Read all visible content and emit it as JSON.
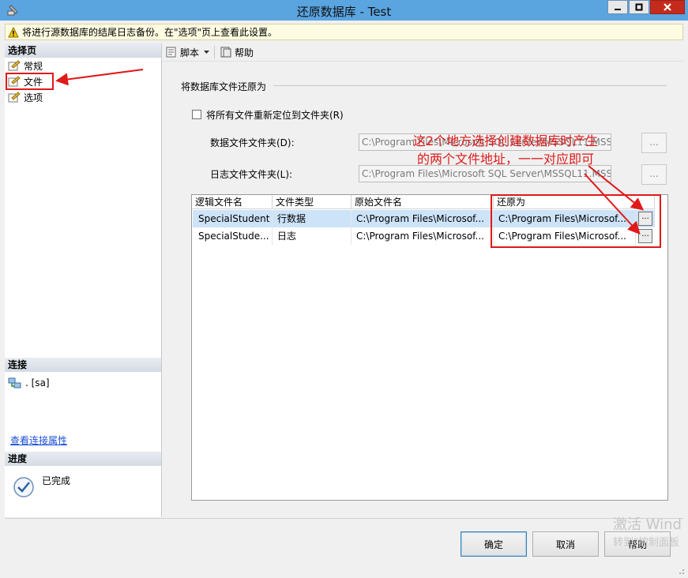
{
  "window": {
    "title": "还原数据库 - Test"
  },
  "warning": {
    "text": "将进行源数据库的结尾日志备份。在\"选项\"页上查看此设置。"
  },
  "sidebar": {
    "header": "选择页",
    "items": [
      {
        "label": "常规"
      },
      {
        "label": "文件"
      },
      {
        "label": "选项"
      }
    ]
  },
  "connection": {
    "header": "连接",
    "server": ". [sa]",
    "link": "查看连接属性"
  },
  "progress": {
    "header": "进度",
    "status": "已完成"
  },
  "toolbar": {
    "script": "脚本",
    "help": "帮助"
  },
  "files": {
    "group_title": "将数据库文件还原为",
    "relocate_label": "将所有文件重新定位到文件夹(R)",
    "data_folder_label": "数据文件文件夹(D):",
    "data_folder_value": "C:\\Program Files\\Microsoft SQL Server\\MSSQL11.MSS",
    "log_folder_label": "日志文件文件夹(L):",
    "log_folder_value": "C:\\Program Files\\Microsoft SQL Server\\MSSQL11.MSS",
    "browse_label": "...",
    "columns": [
      "逻辑文件名",
      "文件类型",
      "原始文件名",
      "还原为"
    ],
    "rows": [
      {
        "logical": "SpecialStudent",
        "type": "行数据",
        "original": "C:\\Program Files\\Microsof...",
        "restore_as": "C:\\Program Files\\Microsof..."
      },
      {
        "logical": "SpecialStude...",
        "type": "日志",
        "original": "C:\\Program Files\\Microsof...",
        "restore_as": "C:\\Program Files\\Microsof..."
      }
    ],
    "cell_button": "..."
  },
  "annotation": {
    "line1": "这2个地方选择创建数据库时产生",
    "line2": "的两个文件地址，一一对应即可"
  },
  "buttons": {
    "ok": "确定",
    "cancel": "取消",
    "help": "帮助"
  },
  "watermark": {
    "line1": "激活 Wind",
    "line2": "转到\"控制面板"
  },
  "colors": {
    "titlebar": "#5aa4e0",
    "annotation_red": "#e01919",
    "selected_row": "#cde3f8",
    "link": "#1a4fd6"
  }
}
